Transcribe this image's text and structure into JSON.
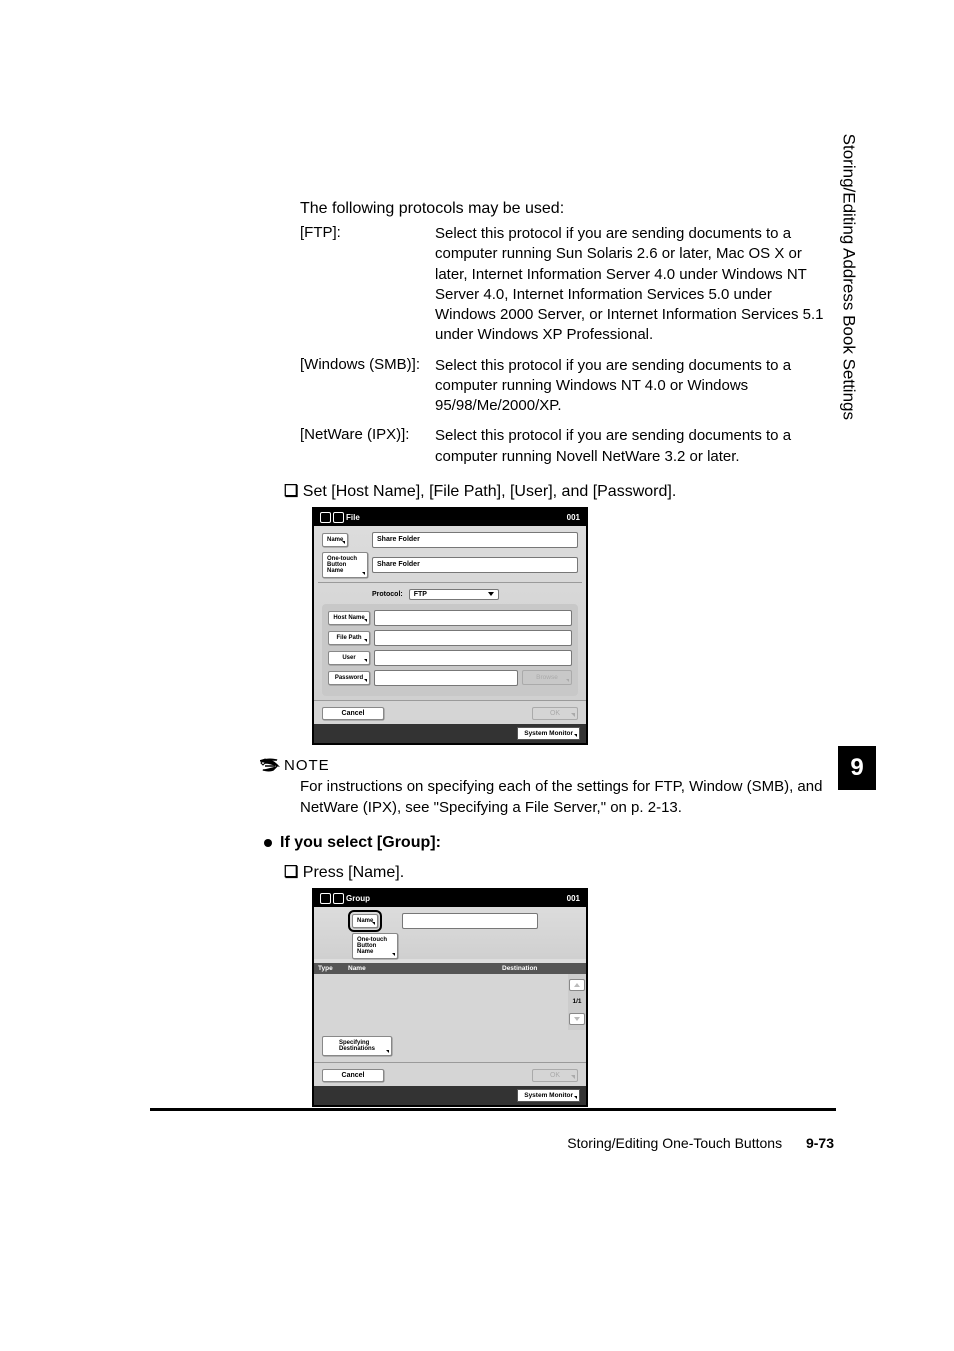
{
  "intro": "The following protocols may be used:",
  "protocols": [
    {
      "term": "[FTP]:",
      "desc": "Select this protocol if you are sending documents to a computer running Sun Solaris 2.6 or later, Mac OS X or later, Internet Information Server 4.0 under Windows NT Server 4.0, Internet Information Services 5.0 under Windows 2000 Server, or Internet Information Services 5.1 under Windows XP Professional."
    },
    {
      "term": "[Windows (SMB)]:",
      "desc": "Select this protocol if you are sending documents to a computer running Windows NT 4.0 or Windows 95/98/Me/2000/XP."
    },
    {
      "term": "[NetWare (IPX)]:",
      "desc": "Select this protocol if you are sending documents to a computer running Novell NetWare 3.2 or later."
    }
  ],
  "set_instruction_prefix": "❏",
  "set_instruction": "Set [Host Name], [File Path], [User], and [Password].",
  "screenshot_file": {
    "title": "File",
    "count": "001",
    "name_btn": "Name",
    "name_value": "Share Folder",
    "onetouch_btn": "One-touch\nButton Name",
    "onetouch_value": "Share Folder",
    "protocol_label": "Protocol:",
    "protocol_value": "FTP",
    "host_btn": "Host Name",
    "file_btn": "File Path",
    "user_btn": "User",
    "pass_btn": "Password",
    "browse_btn": "Browse",
    "cancel": "Cancel",
    "ok": "OK",
    "monitor": "System Monitor"
  },
  "note_label": "NOTE",
  "note_text": "For instructions on specifying each of the settings for FTP, Window (SMB), and NetWare (IPX), see \"Specifying a File Server,\" on p. 2-13.",
  "group_heading": "If you select [Group]:",
  "press_name_prefix": "❏",
  "press_name": "Press [Name].",
  "screenshot_group": {
    "title": "Group",
    "count": "001",
    "name_btn": "Name",
    "onetouch_btn": "One-touch\nButton Name",
    "col_type": "Type",
    "col_name": "Name",
    "col_dest": "Destination",
    "page": "1/1",
    "spec_btn": "Specifying\nDestinations",
    "cancel": "Cancel",
    "ok": "OK",
    "monitor": "System Monitor"
  },
  "side_title": "Storing/Editing Address Book Settings",
  "chapter": "9",
  "footer_title": "Storing/Editing One-Touch Buttons",
  "footer_page": "9-73"
}
